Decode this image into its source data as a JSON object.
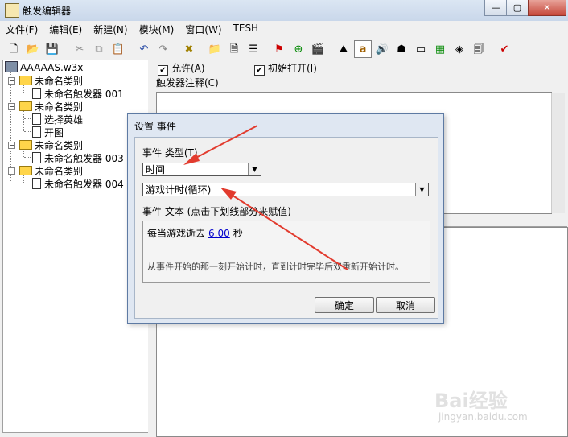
{
  "window": {
    "title": "触发编辑器"
  },
  "menu": [
    "文件(F)",
    "编辑(E)",
    "新建(N)",
    "模块(M)",
    "窗口(W)",
    "TESH"
  ],
  "tree": {
    "root": "AAAAAS.w3x",
    "cat1": "未命名类别",
    "cat1_item1": "未命名触发器 001",
    "cat2": "未命名类别",
    "cat2_item1": "选择英雄",
    "cat2_item2": "开图",
    "cat3": "未命名类别",
    "cat3_item1": "未命名触发器 003",
    "cat4": "未命名类别",
    "cat4_item1": "未命名触发器 004"
  },
  "trigger": {
    "enabled_label": "允许(A)",
    "initially_on_label": "初始打开(I)",
    "comment_label": "触发器注释(C)"
  },
  "dialog": {
    "title": "设置 事件",
    "type_label": "事件 类型(T)",
    "type_value": "时间",
    "event_value": "游戏计时(循环)",
    "text_label": "事件 文本 (点击下划线部分来赋值)",
    "text_prefix": "每当游戏逝去",
    "text_value": "6.00",
    "text_suffix": "秒",
    "description": "从事件开始的那一刻开始计时，直到计时完毕后双重新开始计时。",
    "ok_label": "确定",
    "cancel_label": "取消"
  },
  "watermark": {
    "brand": "Bai经验",
    "url": "jingyan.baidu.com"
  }
}
